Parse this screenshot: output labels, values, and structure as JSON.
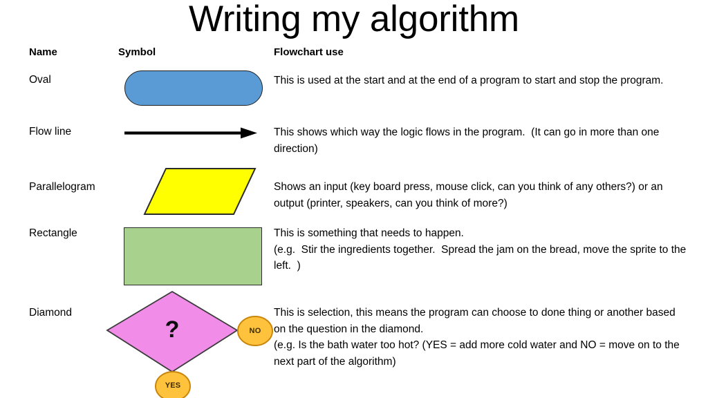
{
  "slide": {
    "title": "Writing my algorithm",
    "background_color": "#FFFFFF"
  },
  "table": {
    "headers": {
      "name": "Name",
      "symbol": "Symbol",
      "use": "Flowchart use"
    },
    "rows": [
      {
        "name": "Oval",
        "symbol": "stadium-shape",
        "fill_color": "#5B9BD5",
        "stroke_color": "#1F1F1F",
        "description": "This is used at the start and at the end of a program to start and stop the program."
      },
      {
        "name": "Flow line",
        "symbol": "arrow-right",
        "fill_color": "#000000",
        "stroke_color": "#000000",
        "description": "This shows which way the logic flows in the program.  (It can go in more than one direction)"
      },
      {
        "name": "Parallelogram",
        "symbol": "parallelogram-shape",
        "fill_color": "#FFFF00",
        "stroke_color": "#2B2B2B",
        "description": "Shows an input (key board press, mouse click, can you think of any others?) or an output (printer, speakers, can you think of more?)"
      },
      {
        "name": "Rectangle",
        "symbol": "rectangle-shape",
        "fill_color": "#A9D18E",
        "stroke_color": "#2B2B2B",
        "description": "This is something that needs to happen.\n(e.g.  Stir the ingredients together.  Spread the jam on the bread, move the sprite to the  left.  )"
      },
      {
        "name": "Diamond",
        "symbol": "diamond-shape",
        "fill_color": "#F18CE8",
        "stroke_color": "#3B3B3B",
        "description": "This is selection, this means the program can choose to done thing or another based on the question in the diamond.\n(e.g. Is the bath water too hot? (YES = add more cold water and NO = move on to the next part of the algorithm)"
      }
    ]
  },
  "diamond_annotations": {
    "question_mark": "?",
    "branch_no": "NO",
    "branch_yes": "YES",
    "badge_fill_color": "#FFC23D",
    "badge_stroke_color": "#C8860D"
  }
}
